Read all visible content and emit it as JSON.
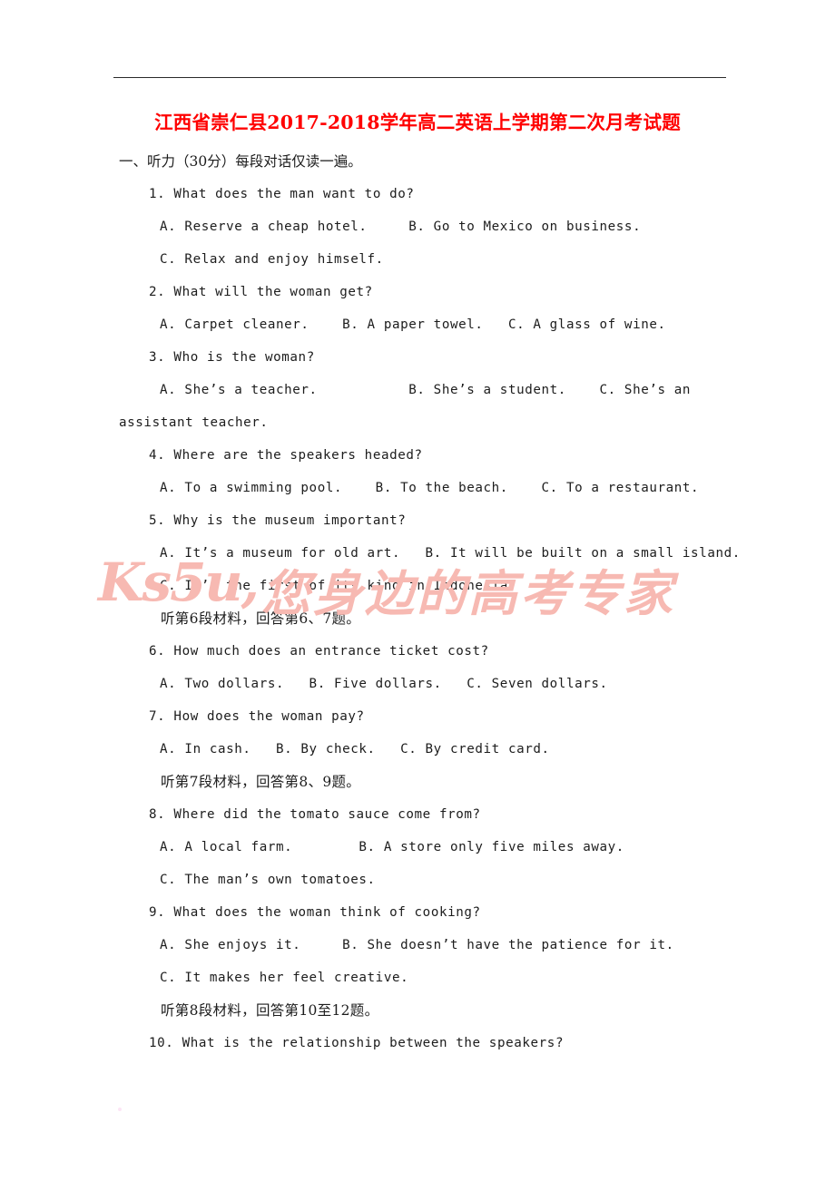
{
  "document": {
    "title": "江西省崇仁县2017-2018学年高二英语上学期第二次月考试题",
    "title_color": "#ff0000",
    "section_heading": "一、听力（30分）每段对话仅读一遍。"
  },
  "watermark": {
    "latin": "Ks5u,",
    "cjk": "您身边的高考专家",
    "color": "#f7b9b2"
  },
  "lines": [
    {
      "indent": "section",
      "text": "一、听力（30分）每段对话仅读一遍。"
    },
    {
      "indent": "q",
      "text": "1. What does the man want to do?"
    },
    {
      "indent": "opt",
      "text": "A. Reserve a cheap hotel.     B. Go to Mexico on business."
    },
    {
      "indent": "opt",
      "text": "C. Relax and enjoy himself."
    },
    {
      "indent": "q",
      "text": "2. What will the woman get?"
    },
    {
      "indent": "opt",
      "text": "A. Carpet cleaner.    B. A paper towel.   C. A glass of wine."
    },
    {
      "indent": "q",
      "text": "3. Who is the woman?"
    },
    {
      "indent": "opt",
      "text": "A. She’s a teacher.           B. She’s a student.    C. She’s an"
    },
    {
      "indent": "cont",
      "text": "assistant teacher."
    },
    {
      "indent": "q",
      "text": "4. Where are the speakers headed?"
    },
    {
      "indent": "opt",
      "text": "A. To a swimming pool.    B. To the beach.    C. To a restaurant."
    },
    {
      "indent": "q",
      "text": "5. Why is the museum important?"
    },
    {
      "indent": "opt",
      "text": "A. It’s a museum for old art.   B. It will be built on a small island."
    },
    {
      "indent": "opt",
      "text": "C. It’s the first of its kind in Indonesia."
    },
    {
      "indent": "note",
      "text": "听第6段材料，回答第6、7题。"
    },
    {
      "indent": "q",
      "text": "6. How much does an entrance ticket cost?"
    },
    {
      "indent": "opt",
      "text": "A. Two dollars.   B. Five dollars.   C. Seven dollars."
    },
    {
      "indent": "q",
      "text": "7. How does the woman pay?"
    },
    {
      "indent": "opt",
      "text": "A. In cash.   B. By check.   C. By credit card."
    },
    {
      "indent": "note",
      "text": "听第7段材料，回答第8、9题。"
    },
    {
      "indent": "q",
      "text": "8. Where did the tomato sauce come from?"
    },
    {
      "indent": "opt",
      "text": "A. A local farm.        B. A store only five miles away."
    },
    {
      "indent": "opt",
      "text": "C. The man’s own tomatoes."
    },
    {
      "indent": "q",
      "text": "9. What does the woman think of cooking?"
    },
    {
      "indent": "opt",
      "text": "A. She enjoys it.     B. She doesn’t have the patience for it."
    },
    {
      "indent": "opt",
      "text": "C. It makes her feel creative."
    },
    {
      "indent": "note",
      "text": "听第8段材料，回答第10至12题。"
    },
    {
      "indent": "q",
      "text": "10. What is the relationship between the speakers?"
    }
  ]
}
